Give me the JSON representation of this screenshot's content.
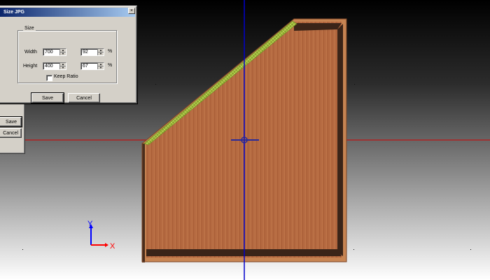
{
  "dialog": {
    "title": "Size JPG",
    "close_glyph": "×",
    "group_label": "Size",
    "width_label": "Width",
    "height_label": "Height",
    "width_px": "700",
    "width_pct": "92",
    "height_px": "400",
    "height_pct": "67",
    "pct_symbol": "%",
    "keep_ratio_label": "Keep Ratio",
    "keep_ratio_checked": false,
    "save_label": "Save",
    "cancel_label": "Cancel",
    "spin_up": "▲",
    "spin_down": "▼"
  },
  "back_dialog": {
    "save_label": "Save",
    "cancel_label": "Cancel"
  },
  "viewport": {
    "axis_x_label": "X",
    "axis_y_label": "Y",
    "axis_x_color": "#ff0000",
    "axis_y_color": "#0000ff",
    "vertical_line_color": "#0000cc",
    "horizontal_line_color": "#cc0000",
    "wood_color": "#b5683f",
    "edge_color": "#9dbb3a"
  }
}
